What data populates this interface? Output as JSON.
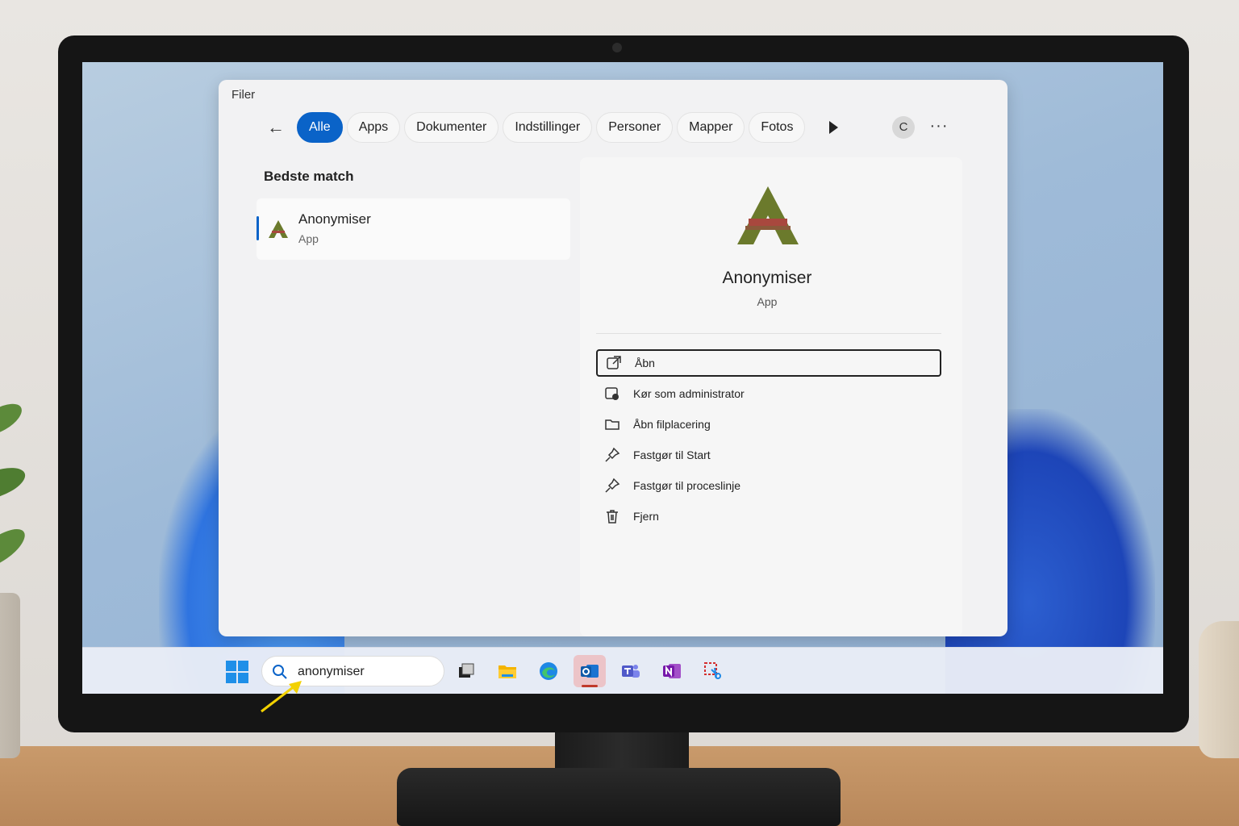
{
  "window": {
    "title": "Filer"
  },
  "tabs": [
    {
      "label": "Alle",
      "active": true
    },
    {
      "label": "Apps"
    },
    {
      "label": "Dokumenter"
    },
    {
      "label": "Indstillinger"
    },
    {
      "label": "Personer"
    },
    {
      "label": "Mapper"
    },
    {
      "label": "Fotos"
    }
  ],
  "profile": {
    "initial": "C"
  },
  "best_match": {
    "heading": "Bedste match",
    "name": "Anonymiser",
    "type": "App"
  },
  "detail": {
    "name": "Anonymiser",
    "type": "App",
    "actions": [
      {
        "label": "Åbn",
        "icon": "open-external-icon"
      },
      {
        "label": "Kør som administrator",
        "icon": "shield-admin-icon"
      },
      {
        "label": "Åbn filplacering",
        "icon": "folder-icon"
      },
      {
        "label": "Fastgør til Start",
        "icon": "pin-icon"
      },
      {
        "label": "Fastgør til proceslinje",
        "icon": "pin-icon"
      },
      {
        "label": "Fjern",
        "icon": "trash-icon"
      }
    ]
  },
  "taskbar": {
    "search_value": "anonymiser",
    "apps": [
      "task-view-icon",
      "file-explorer-icon",
      "edge-icon",
      "outlook-icon",
      "teams-icon",
      "onenote-icon",
      "snipping-tool-icon"
    ]
  },
  "colors": {
    "accent": "#0a63c8",
    "icon_green": "#6b7a2c",
    "icon_red": "#a8483e"
  }
}
